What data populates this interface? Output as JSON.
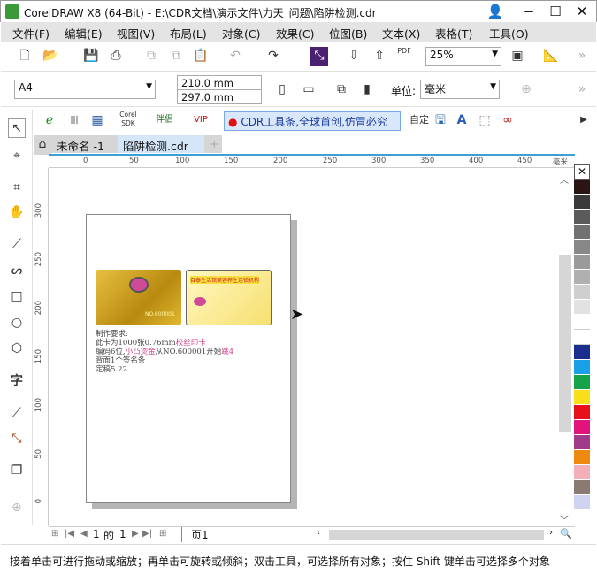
{
  "window": {
    "title": "CorelDRAW X8 (64-Bit) - E:\\CDR文档\\演示文件\\力天_问题\\陷阱检测.cdr",
    "minimize": "−",
    "maximize": "☐",
    "close": "✕"
  },
  "menu": [
    "文件(F)",
    "编辑(E)",
    "视图(V)",
    "布局(L)",
    "对象(C)",
    "效果(C)",
    "位图(B)",
    "文本(X)",
    "表格(T)",
    "工具(O)"
  ],
  "toolbar": {
    "zoom": "25%",
    "pdf": "PDF",
    "more": "»"
  },
  "property_bar": {
    "page_size": "A4",
    "width": "210.0 mm",
    "height": "297.0 mm",
    "unit_label": "单位:",
    "unit": "毫米",
    "more": "»"
  },
  "custom_toolbar": {
    "corel_sdk": "Corel SDK",
    "pair": "伴侣",
    "vip": "VIP",
    "banner": "CDR工具条,全球首创,仿冒必究",
    "text_btn": "自定"
  },
  "tabs": [
    {
      "label": "未命名 -1"
    },
    {
      "label": "陷阱检测.cdr"
    }
  ],
  "tab_add": "+",
  "ruler": {
    "h_ticks": [
      "0",
      "50",
      "100",
      "150",
      "200",
      "250",
      "300",
      "350",
      "400",
      "450"
    ],
    "unit": "毫米",
    "v_ticks": [
      "300",
      "250",
      "200",
      "150",
      "100",
      "50",
      "0"
    ]
  },
  "notes": {
    "l1": "制作要求:",
    "l2a": "此卡为1000张0.76mm",
    "l2b": "校丝印卡",
    "l3a": "编码6位,",
    "l3b": "小凸烫金",
    "l3c": "从NO.600001开始",
    "l3d": "跳4",
    "l4": "背面1个签名条",
    "l5": "定稿5.22"
  },
  "card_back_title": "百泰生活馆美容养生连锁机构",
  "card_front_no": "NO.600001",
  "page_nav": {
    "current": "1",
    "of": "的",
    "total": "1",
    "page_tab": "页1"
  },
  "palette": [
    "#2a1414",
    "#3a3a3a",
    "#5a5a5a",
    "#707070",
    "#888888",
    "#9a9a9a",
    "#b0b0b0",
    "#cfcfcf",
    "#e2e2e2",
    "#ffffff",
    "#ffffff",
    "#1a2e8c",
    "#1aa0e8",
    "#17a34a",
    "#f7e01a",
    "#e8101a",
    "#e0147a",
    "#a03a8a",
    "#ee8a10",
    "#f3b0b8",
    "#8a7a72",
    "#d0d4f0"
  ],
  "status": "接着单击可进行拖动或缩放；再单击可旋转或倾斜；双击工具，可选择所有对象；按住 Shift 键单击可选择多个对象"
}
